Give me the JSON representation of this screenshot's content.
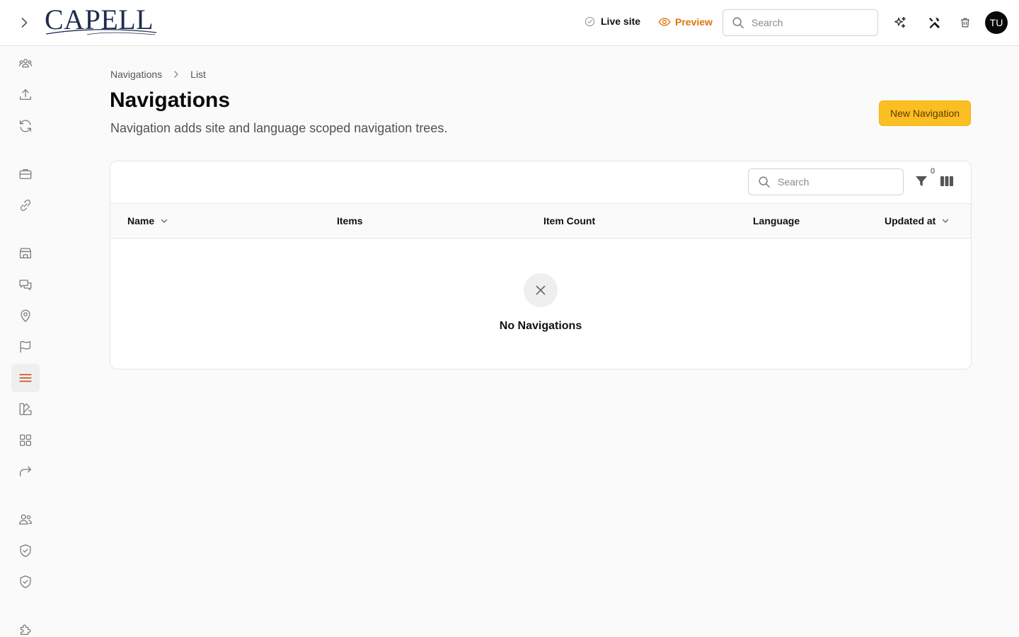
{
  "brand": {
    "logo_text": "CAPELL"
  },
  "topbar": {
    "live_site_label": "Live site",
    "preview_label": "Preview",
    "search_placeholder": "Search",
    "avatar_initials": "TU"
  },
  "sidebar": {
    "items": [
      {
        "icon": "users-group-icon"
      },
      {
        "icon": "upload-icon"
      },
      {
        "icon": "refresh-icon"
      },
      {
        "icon": "briefcase-icon"
      },
      {
        "icon": "link-icon"
      },
      {
        "icon": "store-icon"
      },
      {
        "icon": "chat-bubbles-icon"
      },
      {
        "icon": "map-pin-icon"
      },
      {
        "icon": "flag-icon"
      },
      {
        "icon": "menu-lines-icon",
        "active": true
      },
      {
        "icon": "swatch-icon"
      },
      {
        "icon": "grid-icon"
      },
      {
        "icon": "redirect-icon"
      },
      {
        "icon": "users-icon"
      },
      {
        "icon": "shield-check-icon"
      },
      {
        "icon": "shield-check-icon"
      },
      {
        "icon": "puzzle-icon"
      }
    ]
  },
  "breadcrumb": {
    "items": [
      "Navigations",
      "List"
    ]
  },
  "page": {
    "title": "Navigations",
    "description": "Navigation adds site and language scoped navigation trees.",
    "new_button_label": "New Navigation"
  },
  "table": {
    "search_placeholder": "Search",
    "filter_count": "0",
    "columns": [
      {
        "label": "Name",
        "sortable": true
      },
      {
        "label": "Items",
        "sortable": false
      },
      {
        "label": "Item Count",
        "sortable": false
      },
      {
        "label": "Language",
        "sortable": false
      },
      {
        "label": "Updated at",
        "sortable": true
      }
    ],
    "rows": [],
    "empty_text": "No Navigations"
  },
  "colors": {
    "accent": "#fbbf24",
    "preview": "#d97706",
    "active_nav": "#c2410c"
  }
}
